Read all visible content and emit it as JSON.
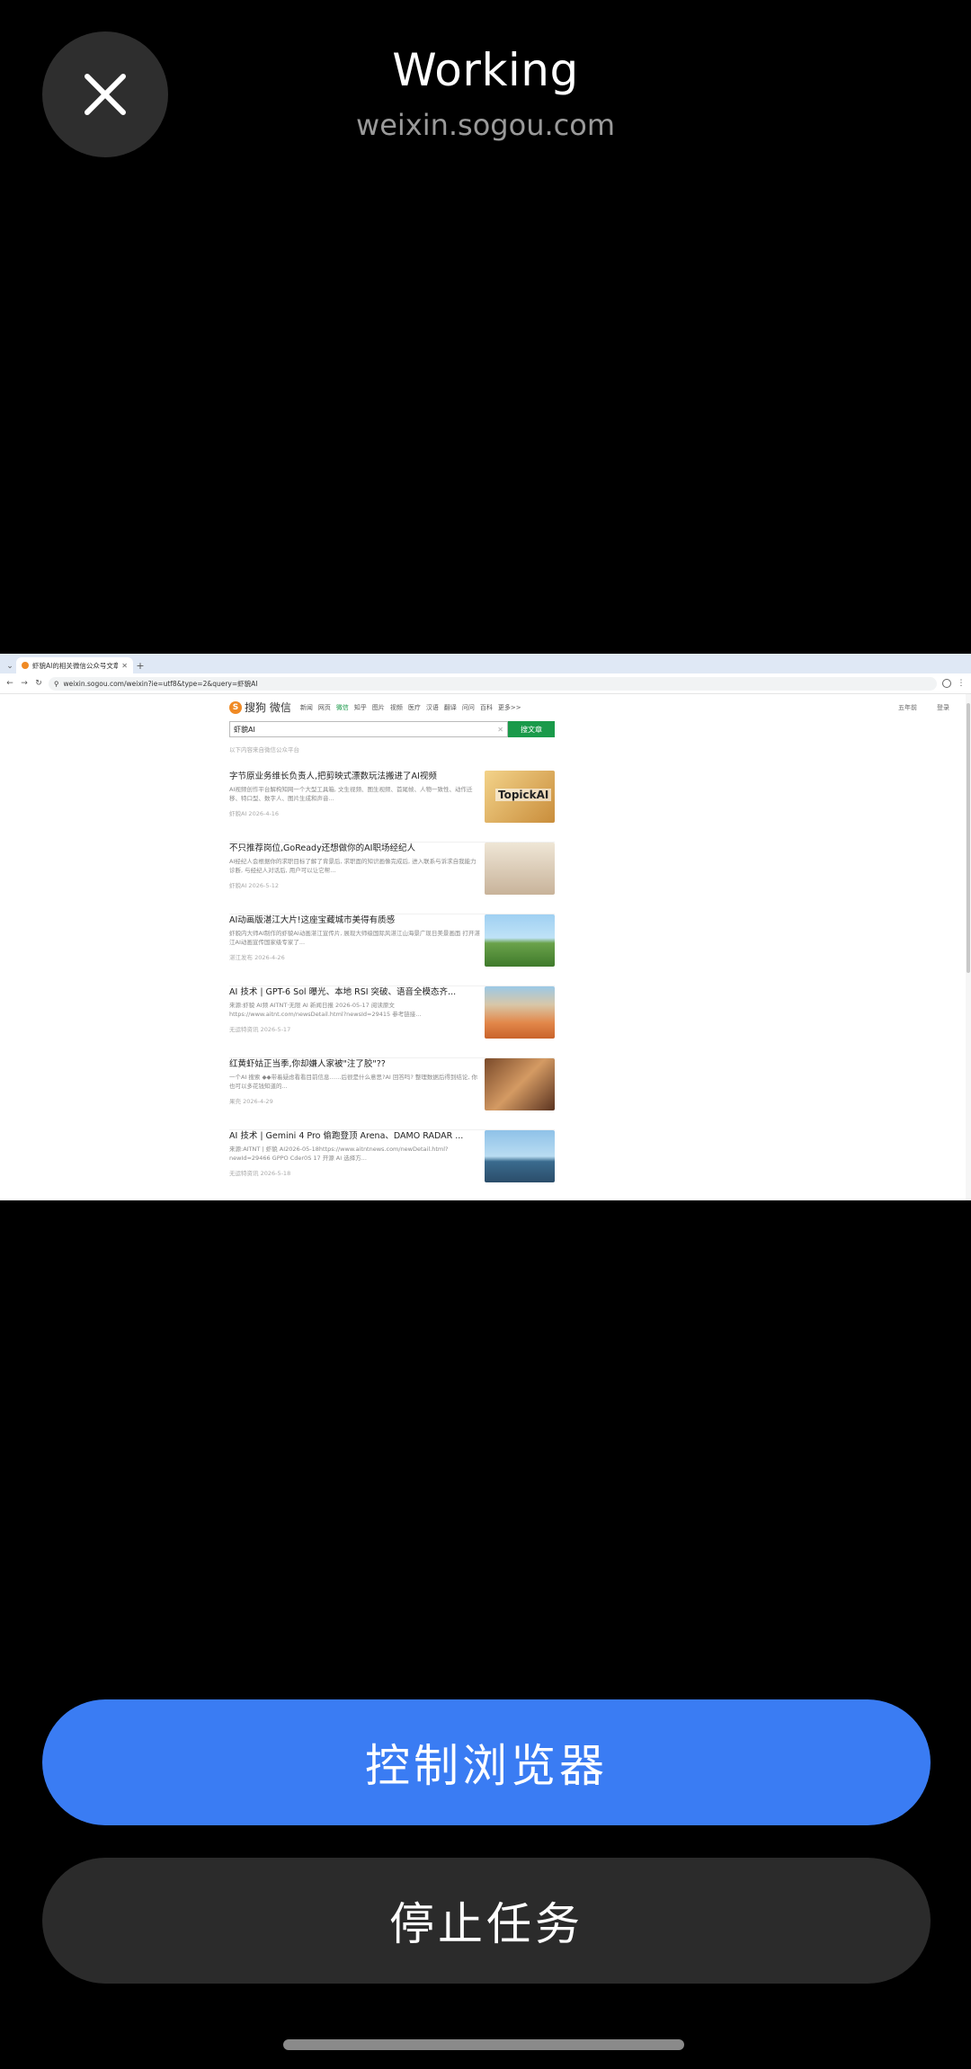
{
  "header": {
    "title": "Working",
    "subtitle": "weixin.sogou.com",
    "close_icon": "close-icon"
  },
  "browser": {
    "tab_title": "虾貌AI的相关微信公众号文章",
    "url": "weixin.sogou.com/weixin?ie=utf8&type=2&query=虾貌AI",
    "sogou": {
      "logo_text": "搜狗 微信",
      "nav": [
        "新闻",
        "网页",
        "微信",
        "知乎",
        "图片",
        "视频",
        "医疗",
        "汉语",
        "翻译",
        "问问",
        "百科",
        "更多>>"
      ],
      "active_nav": "微信",
      "right_links": [
        "五年前",
        "登录"
      ],
      "search_value": "虾貌AI",
      "search_button": "搜文章",
      "hint": "以下内容来自微信公众平台"
    },
    "results": [
      {
        "title": "字节原业务维长负责人,把剪映式漂数玩法搬进了AI视频",
        "snippet": "AI视频创作平台解构知网一个大型工具箱, 文生视频、图生视频、首尾帧、人物一致性、动作迁移、特口型、数字人、图片生成和声音...",
        "meta": "虾貌AI  2026-4-16",
        "thumb_label": "TopickAI"
      },
      {
        "title": "不只推荐岗位,GoReady还想做你的AI职场经纪人",
        "snippet": "AI经纪人会根据你的求职目标了解了背景后, 求职面的知识画像完成后, 进入联系与诉求自我能力诊断, 与经纪人对话后, 用户可以让它帮...",
        "meta": "虾貌AI  2026-5-12",
        "thumb_label": ""
      },
      {
        "title": "AI动画版湛江大片!这座宝藏城市美得有质感",
        "snippet": "虾貌内大师AI制作的虾貌AI动画湛江宣传片, 展现大师级国际风湛江山海景广现日美景画面 打开湛江AI动画宣传国家级专家了...",
        "meta": "湛江发布  2026-4-26",
        "thumb_label": ""
      },
      {
        "title": "AI 技术 | GPT-6 Sol 曝光、本地 RSI 突破、语音全模态齐...",
        "snippet": "来源:虾貌 AI频 AITNT·无限 AI 新闻日报 2026-05-17 阅读原文https://www.aitnt.com/newsDetail.html?newsId=29415 参考链接...",
        "meta": "无运特资讯  2026-5-17",
        "thumb_label": ""
      },
      {
        "title": "红黄虾姑正当季,你却嫌人家被\"注了胶\"??",
        "snippet": "一个AI 搜索 ◆◆带着疑虑看看目前信息……后很是什么意思?AI 回答吗? 整理数据后得到结论, 你也可以多花钱知道的...",
        "meta": "果壳  2026-4-29",
        "thumb_label": ""
      },
      {
        "title": "AI 技术 | Gemini 4 Pro 偷跑登顶 Arena、DAMO RADAR ...",
        "snippet": "来源:AITNT | 虾貌 AI2026-05-18https://www.aitntnews.com/newDetail.html?newId=29466 GPPO Cder0S 17 开源 AI 选择方...",
        "meta": "无运特资讯  2026-5-18",
        "thumb_label": ""
      }
    ]
  },
  "actions": {
    "control_browser": "控制浏览器",
    "stop_task": "停止任务"
  },
  "colors": {
    "primary": "#3a7cf3",
    "secondary": "#2b2b2b",
    "background": "#000000",
    "sogou_green": "#1a9a4a"
  }
}
